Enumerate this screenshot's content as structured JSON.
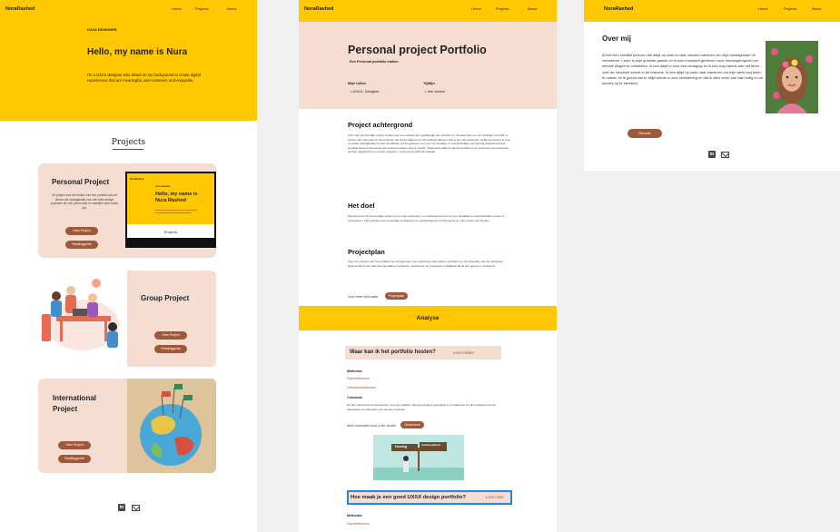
{
  "panel1": {
    "nav": {
      "logo": "NoraRashed",
      "home": "Home",
      "projects": "Projects",
      "about": "About"
    },
    "hero": {
      "eyebrow": "UX/UI DESIGNER",
      "title": "Hello,  my name is Nura",
      "text": "I'm a UX/UI designer who draws on my background to create digital experiences that are meaningful, user-centered, and enjoyable."
    },
    "projects_title": "Projects",
    "card1": {
      "title": "Personal Project",
      "text": "Dit project was het maken van een portfolio dat zal dienen als opslagplaats voor alle toekomstige projecten die van persoonlijk en zakelijke aard zullen zijn.",
      "btn_view": "View Project",
      "btn_read": "Readingguide",
      "mock_logo": "NoraRashed",
      "mock_eyebrow": "UX/UI DESIGNER",
      "mock_title": "Hello,  my name is Nura Rashed",
      "mock_projects": "Projects"
    },
    "card2": {
      "title": "Group Project",
      "btn_view": "View Project",
      "btn_read": "Readingguide"
    },
    "card3": {
      "title": "International Project",
      "btn_view": "View Project",
      "btn_read": "Readingguide"
    }
  },
  "panel2": {
    "nav": {
      "logo": "NoraRashed",
      "home": "Home",
      "projects": "Projects",
      "about": "About"
    },
    "header": {
      "title": "Personal project Portfolio",
      "subtitle": "Een Personal portfolio maken",
      "roles_label": "Mijn rollen",
      "roles_value": "UX/UI- Designer",
      "time_label": "Tijdlijn",
      "time_value": "Vier weken"
    },
    "sections": [
      {
        "title": "Project achtergrond",
        "text": "Voor mijn persoonlijke project hebben we een website die tegelijkertijd een portfolio is. Het doel was om een duidelijk overzicht te bieden van mijn werk en de projecten die ik heb uitgevoerd. Dit portfolio laat zien wie ik ben als ontwerper, welke processen ik volg en welke vaardigheden ik heb ontwikkeld. Ik heb gekozen voor een eenvoudige en overzichtelijke vormgeving zodat de inhoud centraal staat en bezoekers snel kunnen vinden wat ze zoeken. Daarnaast wilde ik dat het portfolio in de toekomst eenvoudig kan worden uitgebreid met nieuwe projecten, zowel persoonlijk als zakelijk."
      },
      {
        "title": "Het doel",
        "text": "Mijn doel met dit persoonlijke project is om mijn ontwerpen en ontwerpprocessen op een duidelijke en aantrekkelijke manier te presenteren. Het portfolio moet potentiële werkgevers en opdrachtgevers inzicht geven in mijn manier van werken."
      },
      {
        "title": "Projectplan",
        "text": "Voor het ontwerp van het portfolio ben ik begonnen met onderzoek naar andere portfolio's en de behoeften van de doelgroep. Daarna heb ik een planning gemaakt en schetsen, wireframes en prototypes ontwikkeld die ik heb getest en verbeterd."
      }
    ],
    "read_more_label": "Voor meer informatie",
    "read_more_btn": "Projectplan",
    "band": "Analyse",
    "q1": {
      "title": "Waar kan ik het portfolio hosten?",
      "link": "Lees minder"
    },
    "methods_label": "Methodes",
    "method_a": "Expertinterview",
    "method_b": "Literatuuronderzoek",
    "conclusion_label": "Conclusie",
    "conclusion_text": "Na het onderzoek heb ik gekozen voor een platform dat eenvoudig te gebruiken is en waarmee ik mijn portfolio snel kan aanpassen en uitbreiden met nieuwe projecten.",
    "more_info_label": "Meer informatie kunt u hier vinden",
    "more_info_btn": "Onderzoek",
    "sign": {
      "left": "Hosting",
      "right": "Another platform"
    },
    "q2": {
      "title": "Hoe maak je een goed UX/UI design portfolio?",
      "link": "Lees meer"
    },
    "methods_label2": "Methodes",
    "method_c": "Expertinterview"
  },
  "panel3": {
    "nav": {
      "logo": "NoraRashed",
      "home": "Home",
      "projects": "Projects",
      "about": "About"
    },
    "title": "Over mij",
    "text": "Ik ben een creatief persoon die altijd op zoek is naar nieuwe manieren om mijn vaardigheden te verbeteren. Leren is mijn grootste passie en ik word constant gedreven door nieuwsgierigheid om nieuwe dingen te ontdekken. Ik ben altijd in voor een uitdaging en ik ben nog steeds aan het leren over de nieuwste trends in de branche. Ik ben altijd op zoek naar manieren om mijn werk nog beter te maken en ik geloof dat er altijd ruimte is voor verbetering en dat ik alles leren kan wat nodig is om succes op te bereiken.",
    "resume_btn": "Resume"
  },
  "colors": {
    "accent": "#ffc800",
    "peach": "#f5ddd1",
    "button": "#a0583a",
    "highlight_border": "#1e88e5"
  }
}
